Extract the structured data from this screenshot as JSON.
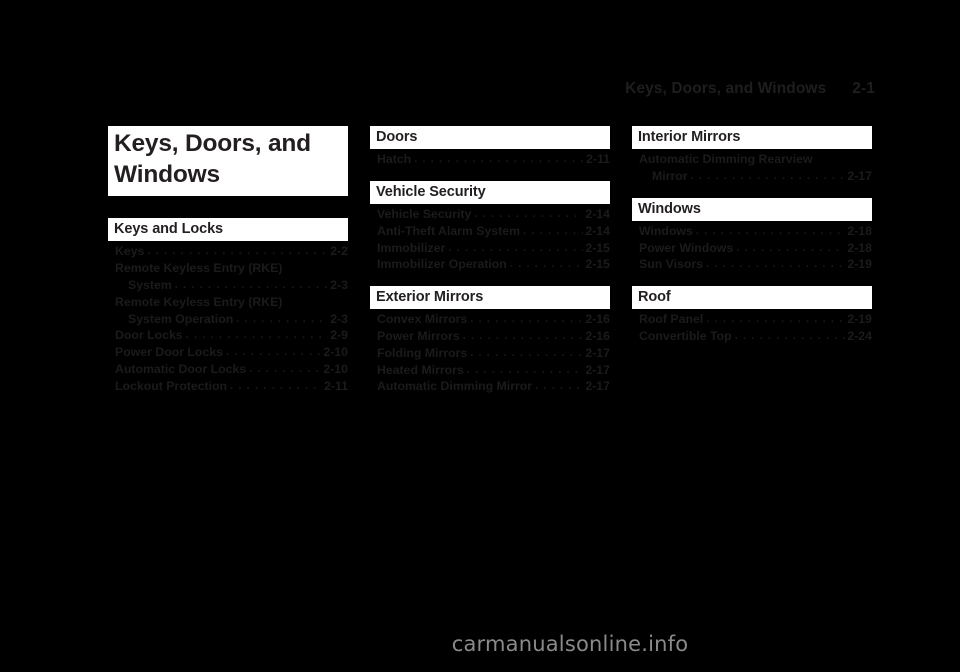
{
  "header": {
    "title": "Keys, Doors, and Windows",
    "page_number": "2-1"
  },
  "chapter_title": {
    "line1": "Keys, Doors, and",
    "line2": "Windows"
  },
  "footer": {
    "watermark": "carmanualsonline.info"
  },
  "columns": [
    {
      "sections": [
        {
          "heading": "Keys and Locks",
          "entries": [
            {
              "text": "Keys",
              "page": "2-2",
              "wrap": false
            },
            {
              "text": "Remote Keyless Entry (RKE)",
              "page": "",
              "wrap": false,
              "nodots": true
            },
            {
              "text": "System",
              "page": "2-3",
              "wrap": true
            },
            {
              "text": "Remote Keyless Entry (RKE)",
              "page": "",
              "wrap": false,
              "nodots": true
            },
            {
              "text": "System Operation",
              "page": "2-3",
              "wrap": true
            },
            {
              "text": "Door Locks",
              "page": "2-9",
              "wrap": false
            },
            {
              "text": "Power Door Locks",
              "page": "2-10",
              "wrap": false
            },
            {
              "text": "Automatic Door Locks",
              "page": "2-10",
              "wrap": false
            },
            {
              "text": "Lockout Protection",
              "page": "2-11",
              "wrap": false
            }
          ]
        }
      ]
    },
    {
      "sections": [
        {
          "heading": "Doors",
          "entries": [
            {
              "text": "Hatch",
              "page": "2-11",
              "wrap": false
            }
          ]
        },
        {
          "heading": "Vehicle Security",
          "entries": [
            {
              "text": "Vehicle Security",
              "page": "2-14",
              "wrap": false
            },
            {
              "text": "Anti-Theft Alarm System",
              "page": "2-14",
              "wrap": false
            },
            {
              "text": "Immobilizer",
              "page": "2-15",
              "wrap": false
            },
            {
              "text": "Immobilizer Operation",
              "page": "2-15",
              "wrap": false
            }
          ]
        },
        {
          "heading": "Exterior Mirrors",
          "entries": [
            {
              "text": "Convex Mirrors",
              "page": "2-16",
              "wrap": false
            },
            {
              "text": "Power Mirrors",
              "page": "2-16",
              "wrap": false
            },
            {
              "text": "Folding Mirrors",
              "page": "2-17",
              "wrap": false
            },
            {
              "text": "Heated Mirrors",
              "page": "2-17",
              "wrap": false
            },
            {
              "text": "Automatic Dimming Mirror",
              "page": "2-17",
              "wrap": false
            }
          ]
        }
      ]
    },
    {
      "sections": [
        {
          "heading": "Interior Mirrors",
          "entries": [
            {
              "text": "Automatic Dimming Rearview",
              "page": "",
              "wrap": false,
              "nodots": true
            },
            {
              "text": "Mirror",
              "page": "2-17",
              "wrap": true
            }
          ]
        },
        {
          "heading": "Windows",
          "entries": [
            {
              "text": "Windows",
              "page": "2-18",
              "wrap": false
            },
            {
              "text": "Power Windows",
              "page": "2-18",
              "wrap": false
            },
            {
              "text": "Sun Visors",
              "page": "2-19",
              "wrap": false
            }
          ]
        },
        {
          "heading": "Roof",
          "entries": [
            {
              "text": "Roof Panel",
              "page": "2-19",
              "wrap": false
            },
            {
              "text": "Convertible Top",
              "page": "2-24",
              "wrap": false
            }
          ]
        }
      ]
    }
  ]
}
